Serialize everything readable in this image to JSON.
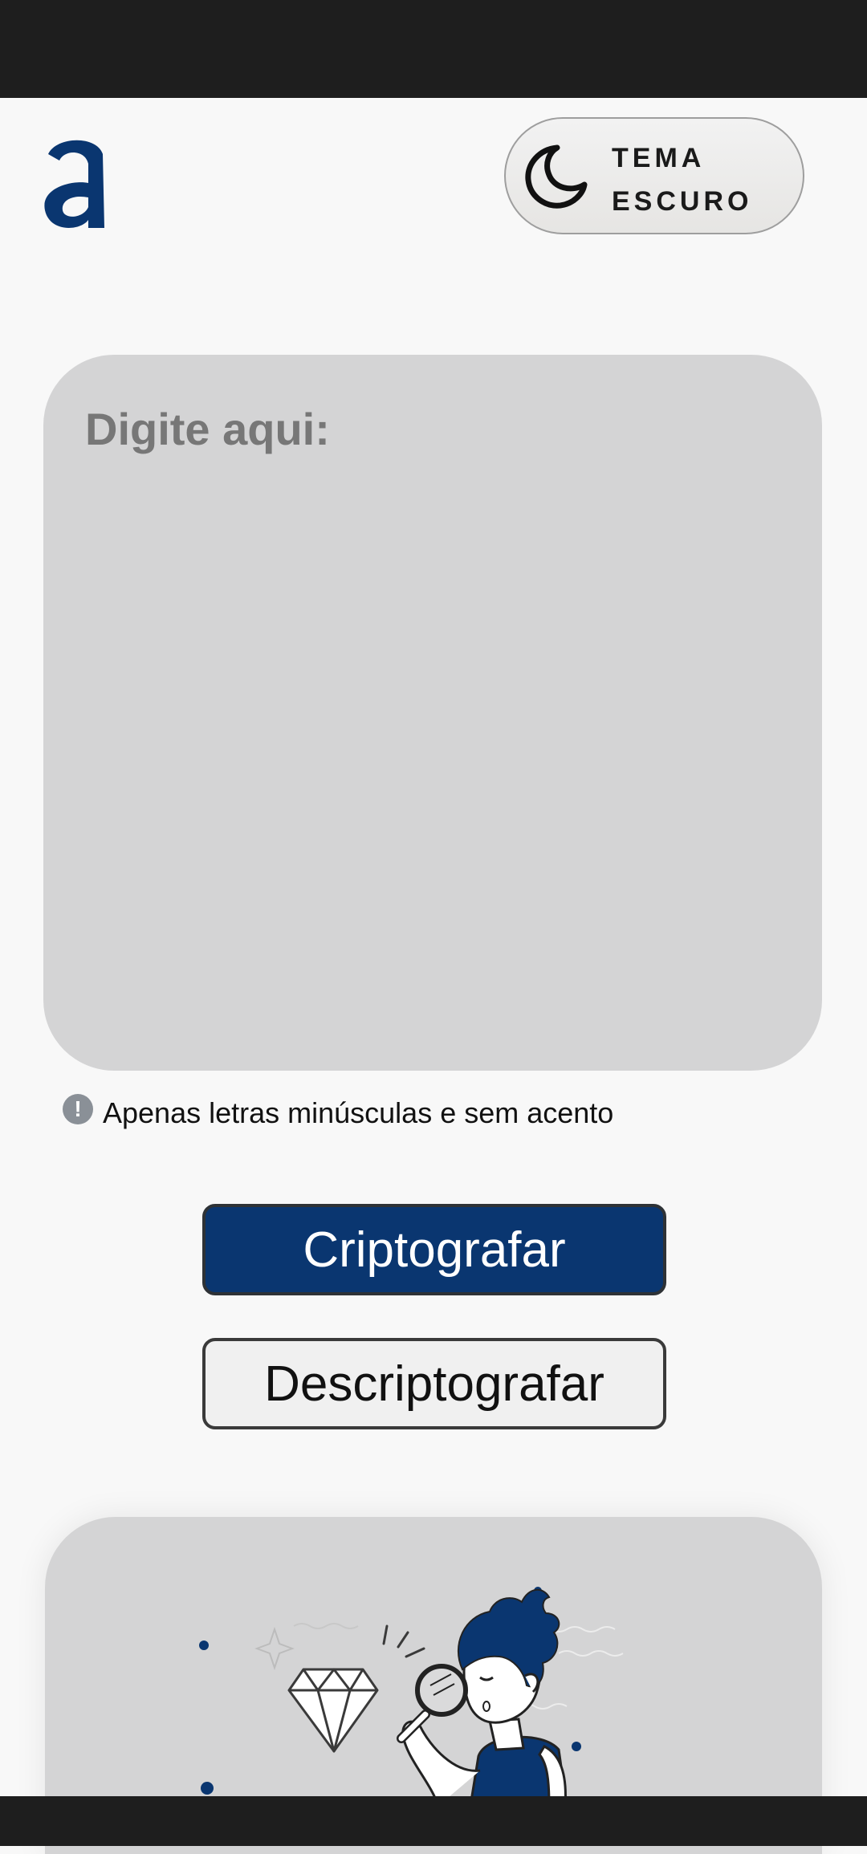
{
  "header": {
    "logo_letter": "a",
    "logo_icon": "a-logo-icon",
    "theme_button": {
      "icon": "moon-icon",
      "line1": "TEMA",
      "line2": "ESCURO"
    }
  },
  "input": {
    "placeholder": "Digite aqui:",
    "value": ""
  },
  "hint": {
    "icon": "exclamation-icon",
    "text": "Apenas letras minúsculas e sem acento"
  },
  "buttons": {
    "encrypt_label": "Criptografar",
    "decrypt_label": "Descriptografar"
  },
  "illustration": {
    "icon": "detective-diamond-illustration"
  },
  "colors": {
    "brand": "#0a3670",
    "background": "#f8f8f8",
    "card": "#d4d4d5",
    "system_bars": "#1e1e1e"
  }
}
